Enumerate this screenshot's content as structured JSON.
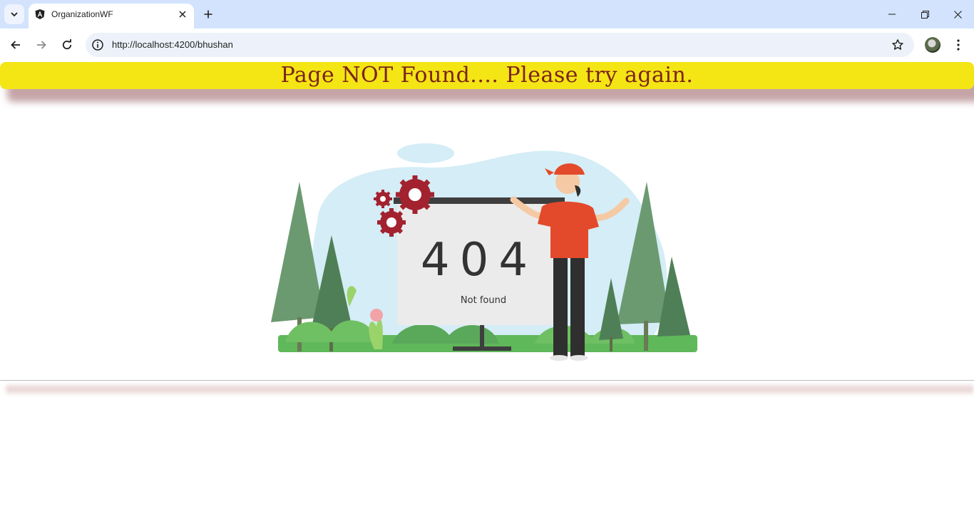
{
  "browser": {
    "tab": {
      "title": "OrganizationWF",
      "favicon": "angular-icon"
    },
    "new_tab_icon": "plus-icon",
    "window_controls": [
      "minimize-icon",
      "restore-icon",
      "close-icon"
    ],
    "address_bar": {
      "url": "http://localhost:4200/bhushan"
    },
    "nav": [
      "back-arrow-icon",
      "forward-arrow-icon",
      "reload-icon"
    ]
  },
  "page": {
    "banner_text": "Page NOT Found.... Please try again.",
    "illustration": {
      "code": "404",
      "caption": "Not found"
    }
  },
  "colors": {
    "tabstrip": "#d3e3fd",
    "banner_bg": "#f4e515",
    "banner_text": "#7b2418",
    "gear": "#a3222f",
    "shirt": "#e34a2b"
  }
}
